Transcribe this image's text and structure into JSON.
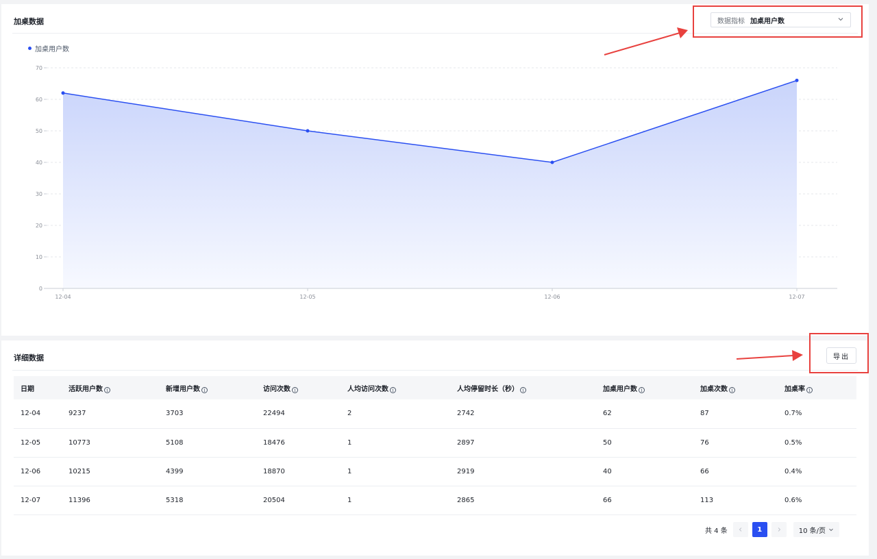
{
  "chart_panel": {
    "title": "加桌数据",
    "metric_select": {
      "label": "数据指标",
      "value": "加桌用户数"
    },
    "legend": "加桌用户数"
  },
  "chart_data": {
    "type": "area",
    "title": "",
    "xlabel": "",
    "ylabel": "",
    "categories": [
      "12-04",
      "12-05",
      "12-06",
      "12-07"
    ],
    "series": [
      {
        "name": "加桌用户数",
        "values": [
          62,
          50,
          40,
          66
        ]
      }
    ],
    "y_ticks": [
      0,
      10,
      20,
      30,
      40,
      50,
      60,
      70
    ],
    "ylim": [
      0,
      70
    ],
    "grid": "horizontal dashed",
    "legend_position": "top-left",
    "colors": {
      "line": "#2a4ff1",
      "fill_top": "#c9d4fb",
      "fill_bottom": "#f7f9ff"
    }
  },
  "table_panel": {
    "title": "详细数据",
    "export_label": "导出",
    "columns": [
      {
        "label": "日期",
        "info": false
      },
      {
        "label": "活跃用户数",
        "info": true
      },
      {
        "label": "新增用户数",
        "info": true
      },
      {
        "label": "访问次数",
        "info": true
      },
      {
        "label": "人均访问次数",
        "info": true
      },
      {
        "label": "人均停留时长（秒）",
        "info": true
      },
      {
        "label": "加桌用户数",
        "info": true
      },
      {
        "label": "加桌次数",
        "info": true
      },
      {
        "label": "加桌率",
        "info": true
      }
    ],
    "rows": [
      [
        "12-04",
        "9237",
        "3703",
        "22494",
        "2",
        "2742",
        "62",
        "87",
        "0.7%"
      ],
      [
        "12-05",
        "10773",
        "5108",
        "18476",
        "1",
        "2897",
        "50",
        "76",
        "0.5%"
      ],
      [
        "12-06",
        "10215",
        "4399",
        "18870",
        "1",
        "2919",
        "40",
        "66",
        "0.4%"
      ],
      [
        "12-07",
        "11396",
        "5318",
        "20504",
        "1",
        "2865",
        "66",
        "113",
        "0.6%"
      ]
    ],
    "pagination": {
      "total_text": "共 4 条",
      "current_page": "1",
      "page_size": "10 条/页"
    }
  },
  "colors": {
    "accent": "#2a4ff1",
    "annotation": "#e8413e"
  },
  "icons": {
    "dropdown": "chevron-down-icon",
    "info": "info-icon",
    "prev": "chevron-left-icon",
    "next": "chevron-right-icon"
  }
}
